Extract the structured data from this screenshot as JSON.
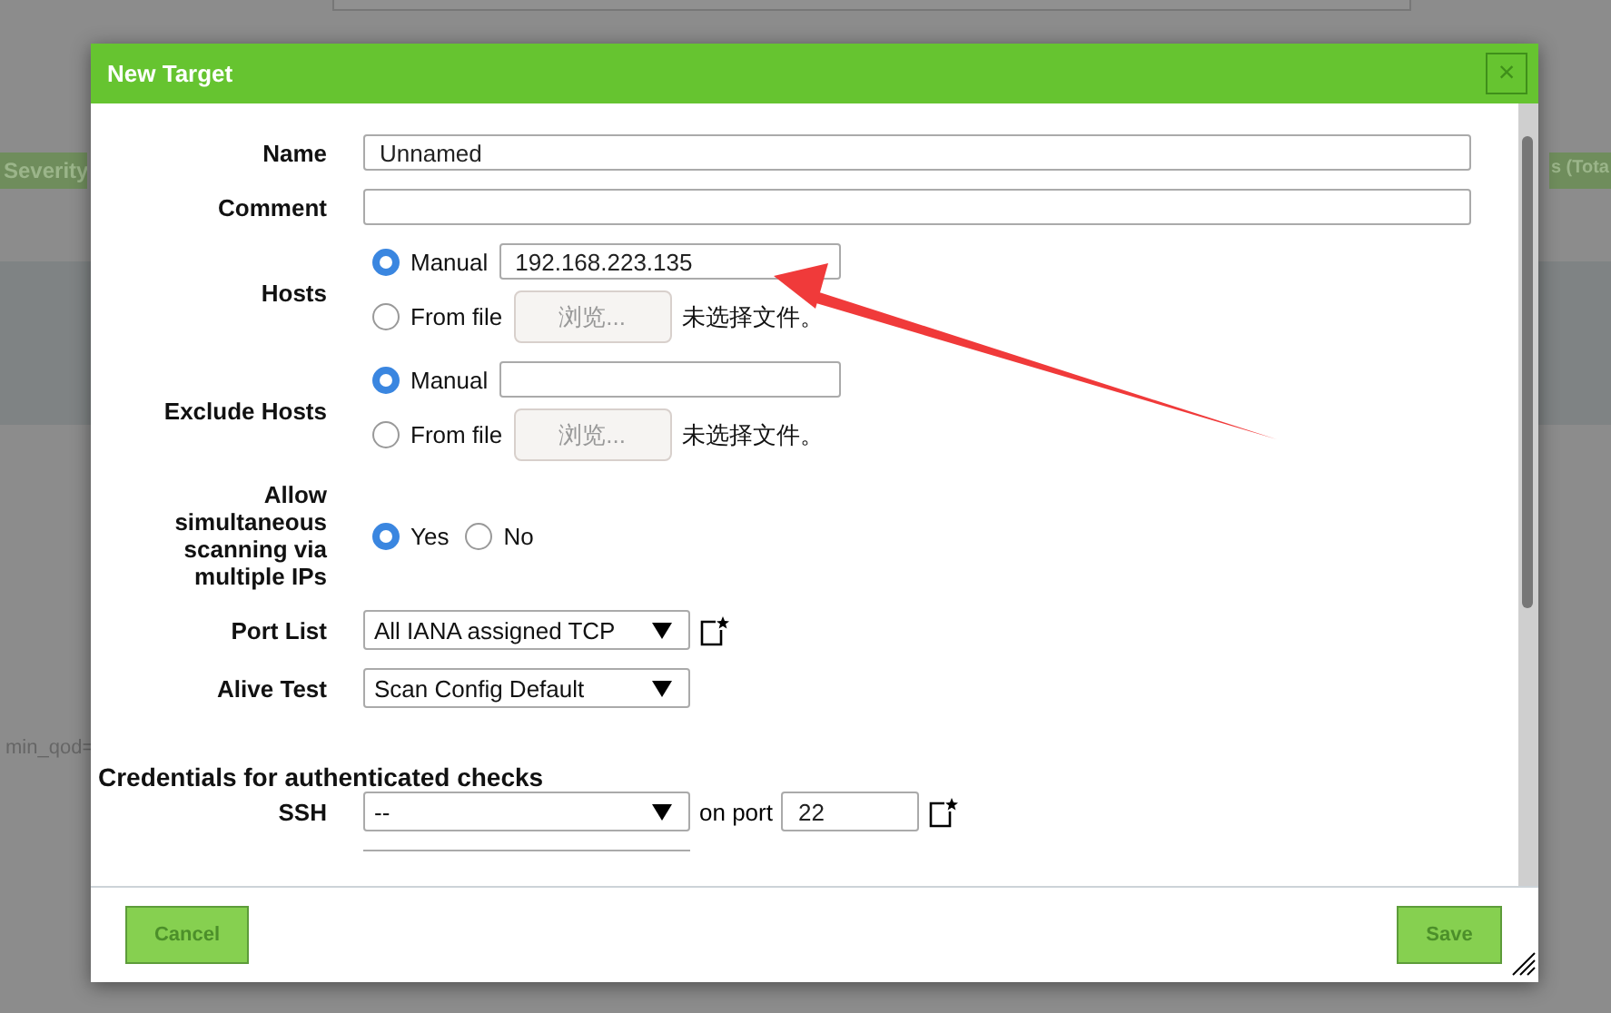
{
  "background": {
    "left_header": "Severity",
    "right_header": "s (Tota",
    "left_text": "min_qod="
  },
  "dialog": {
    "title": "New Target",
    "close": "×",
    "name": {
      "label": "Name",
      "value": "Unnamed"
    },
    "comment": {
      "label": "Comment"
    },
    "hosts": {
      "label": "Hosts",
      "options": [
        {
          "kind": "text",
          "label": "Manual",
          "selected": true,
          "value": "192.168.223.135"
        },
        {
          "kind": "file",
          "label": "From file",
          "selected": false,
          "button": "浏览...",
          "status": "未选择文件。"
        }
      ]
    },
    "exclude_hosts": {
      "label": "Exclude Hosts",
      "options": [
        {
          "kind": "text",
          "label": "Manual",
          "selected": true
        },
        {
          "kind": "file",
          "label": "From file",
          "selected": false,
          "button": "浏览...",
          "status": "未选择文件。"
        }
      ]
    },
    "simultaneous": {
      "label": "Allow simultaneous scanning via multiple IPs",
      "options": [
        {
          "label": "Yes",
          "selected": true
        },
        {
          "label": "No",
          "selected": false
        }
      ]
    },
    "port_list": {
      "label": "Port List",
      "value": "All IANA assigned TCP"
    },
    "alive_test": {
      "label": "Alive Test",
      "value": "Scan Config Default"
    },
    "credentials_heading": "Credentials for authenticated checks",
    "ssh": {
      "label": "SSH",
      "value": "--",
      "port_label": "on port",
      "port": "22"
    },
    "buttons": {
      "cancel": "Cancel",
      "save": "Save"
    }
  }
}
